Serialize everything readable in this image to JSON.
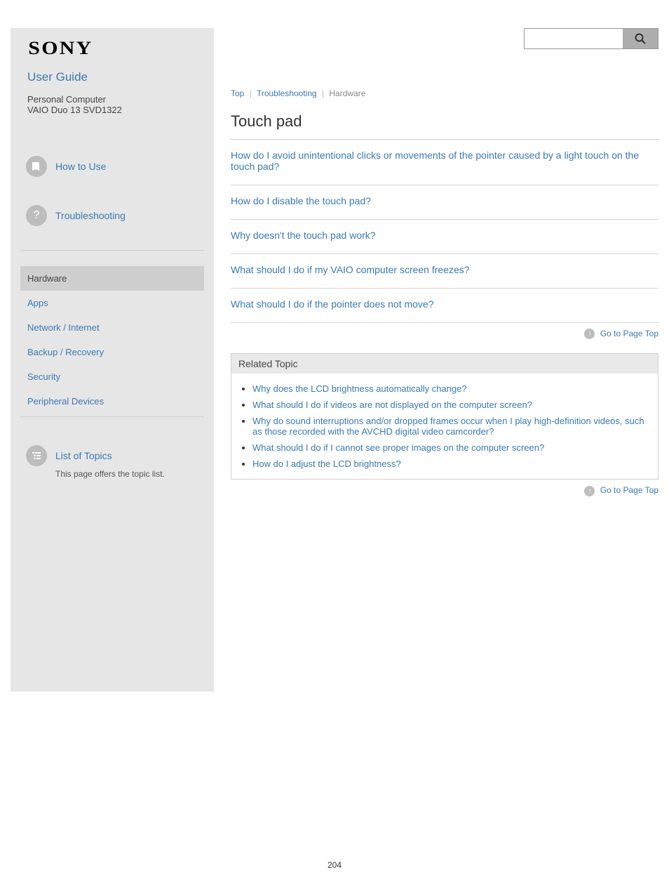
{
  "logo": "SONY",
  "guide_link": "User Guide",
  "model": {
    "line1": "Personal Computer",
    "line2": "VAIO Duo 13 SVD1322"
  },
  "nav": {
    "howto": "How to Use",
    "trouble": "Troubleshooting"
  },
  "subnav": {
    "hardware": "Hardware",
    "apps": "Apps",
    "network": "Network / Internet",
    "backup": "Backup / Recovery",
    "security": "Security",
    "peripheral": "Peripheral Devices"
  },
  "contents": {
    "label": "List of Topics",
    "desc": "This page offers the topic list."
  },
  "breadcrumb": {
    "top": "Top",
    "trouble": "Troubleshooting",
    "current": "Hardware"
  },
  "page_title": "Touch pad",
  "items": [
    {
      "title": "How do I avoid unintentional clicks or movements of the pointer caused by a light touch on the touch pad?",
      "desc": ""
    },
    {
      "title": "How do I disable the touch pad?",
      "desc": ""
    },
    {
      "title": "Why doesn't the touch pad work?",
      "desc": ""
    },
    {
      "title": "What should I do if my VAIO computer screen freezes?",
      "desc": ""
    },
    {
      "title": "What should I do if the pointer does not move?",
      "desc": ""
    }
  ],
  "goto": "Go to Page Top",
  "related": {
    "title": "Related Topic",
    "links": [
      "Why does the LCD brightness automatically change?",
      "What should I do if videos are not displayed on the computer screen?",
      "Why do sound interruptions and/or dropped frames occur when I play high-definition videos, such as those recorded with the AVCHD digital video camcorder?",
      "What should I do if I cannot see proper images on the computer screen?",
      "How do I adjust the LCD brightness?"
    ]
  },
  "page_number": "204"
}
